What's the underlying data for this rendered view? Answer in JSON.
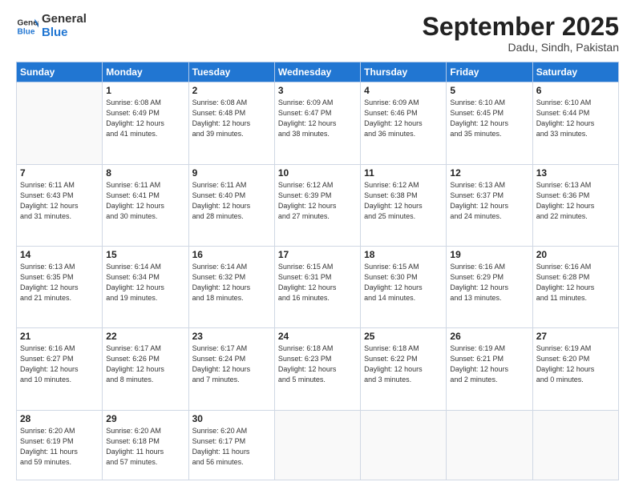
{
  "header": {
    "logo_general": "General",
    "logo_blue": "Blue",
    "month_title": "September 2025",
    "location": "Dadu, Sindh, Pakistan"
  },
  "calendar": {
    "days_of_week": [
      "Sunday",
      "Monday",
      "Tuesday",
      "Wednesday",
      "Thursday",
      "Friday",
      "Saturday"
    ],
    "weeks": [
      [
        {
          "day": "",
          "info": ""
        },
        {
          "day": "1",
          "info": "Sunrise: 6:08 AM\nSunset: 6:49 PM\nDaylight: 12 hours\nand 41 minutes."
        },
        {
          "day": "2",
          "info": "Sunrise: 6:08 AM\nSunset: 6:48 PM\nDaylight: 12 hours\nand 39 minutes."
        },
        {
          "day": "3",
          "info": "Sunrise: 6:09 AM\nSunset: 6:47 PM\nDaylight: 12 hours\nand 38 minutes."
        },
        {
          "day": "4",
          "info": "Sunrise: 6:09 AM\nSunset: 6:46 PM\nDaylight: 12 hours\nand 36 minutes."
        },
        {
          "day": "5",
          "info": "Sunrise: 6:10 AM\nSunset: 6:45 PM\nDaylight: 12 hours\nand 35 minutes."
        },
        {
          "day": "6",
          "info": "Sunrise: 6:10 AM\nSunset: 6:44 PM\nDaylight: 12 hours\nand 33 minutes."
        }
      ],
      [
        {
          "day": "7",
          "info": "Sunrise: 6:11 AM\nSunset: 6:43 PM\nDaylight: 12 hours\nand 31 minutes."
        },
        {
          "day": "8",
          "info": "Sunrise: 6:11 AM\nSunset: 6:41 PM\nDaylight: 12 hours\nand 30 minutes."
        },
        {
          "day": "9",
          "info": "Sunrise: 6:11 AM\nSunset: 6:40 PM\nDaylight: 12 hours\nand 28 minutes."
        },
        {
          "day": "10",
          "info": "Sunrise: 6:12 AM\nSunset: 6:39 PM\nDaylight: 12 hours\nand 27 minutes."
        },
        {
          "day": "11",
          "info": "Sunrise: 6:12 AM\nSunset: 6:38 PM\nDaylight: 12 hours\nand 25 minutes."
        },
        {
          "day": "12",
          "info": "Sunrise: 6:13 AM\nSunset: 6:37 PM\nDaylight: 12 hours\nand 24 minutes."
        },
        {
          "day": "13",
          "info": "Sunrise: 6:13 AM\nSunset: 6:36 PM\nDaylight: 12 hours\nand 22 minutes."
        }
      ],
      [
        {
          "day": "14",
          "info": "Sunrise: 6:13 AM\nSunset: 6:35 PM\nDaylight: 12 hours\nand 21 minutes."
        },
        {
          "day": "15",
          "info": "Sunrise: 6:14 AM\nSunset: 6:34 PM\nDaylight: 12 hours\nand 19 minutes."
        },
        {
          "day": "16",
          "info": "Sunrise: 6:14 AM\nSunset: 6:32 PM\nDaylight: 12 hours\nand 18 minutes."
        },
        {
          "day": "17",
          "info": "Sunrise: 6:15 AM\nSunset: 6:31 PM\nDaylight: 12 hours\nand 16 minutes."
        },
        {
          "day": "18",
          "info": "Sunrise: 6:15 AM\nSunset: 6:30 PM\nDaylight: 12 hours\nand 14 minutes."
        },
        {
          "day": "19",
          "info": "Sunrise: 6:16 AM\nSunset: 6:29 PM\nDaylight: 12 hours\nand 13 minutes."
        },
        {
          "day": "20",
          "info": "Sunrise: 6:16 AM\nSunset: 6:28 PM\nDaylight: 12 hours\nand 11 minutes."
        }
      ],
      [
        {
          "day": "21",
          "info": "Sunrise: 6:16 AM\nSunset: 6:27 PM\nDaylight: 12 hours\nand 10 minutes."
        },
        {
          "day": "22",
          "info": "Sunrise: 6:17 AM\nSunset: 6:26 PM\nDaylight: 12 hours\nand 8 minutes."
        },
        {
          "day": "23",
          "info": "Sunrise: 6:17 AM\nSunset: 6:24 PM\nDaylight: 12 hours\nand 7 minutes."
        },
        {
          "day": "24",
          "info": "Sunrise: 6:18 AM\nSunset: 6:23 PM\nDaylight: 12 hours\nand 5 minutes."
        },
        {
          "day": "25",
          "info": "Sunrise: 6:18 AM\nSunset: 6:22 PM\nDaylight: 12 hours\nand 3 minutes."
        },
        {
          "day": "26",
          "info": "Sunrise: 6:19 AM\nSunset: 6:21 PM\nDaylight: 12 hours\nand 2 minutes."
        },
        {
          "day": "27",
          "info": "Sunrise: 6:19 AM\nSunset: 6:20 PM\nDaylight: 12 hours\nand 0 minutes."
        }
      ],
      [
        {
          "day": "28",
          "info": "Sunrise: 6:20 AM\nSunset: 6:19 PM\nDaylight: 11 hours\nand 59 minutes."
        },
        {
          "day": "29",
          "info": "Sunrise: 6:20 AM\nSunset: 6:18 PM\nDaylight: 11 hours\nand 57 minutes."
        },
        {
          "day": "30",
          "info": "Sunrise: 6:20 AM\nSunset: 6:17 PM\nDaylight: 11 hours\nand 56 minutes."
        },
        {
          "day": "",
          "info": ""
        },
        {
          "day": "",
          "info": ""
        },
        {
          "day": "",
          "info": ""
        },
        {
          "day": "",
          "info": ""
        }
      ]
    ]
  }
}
